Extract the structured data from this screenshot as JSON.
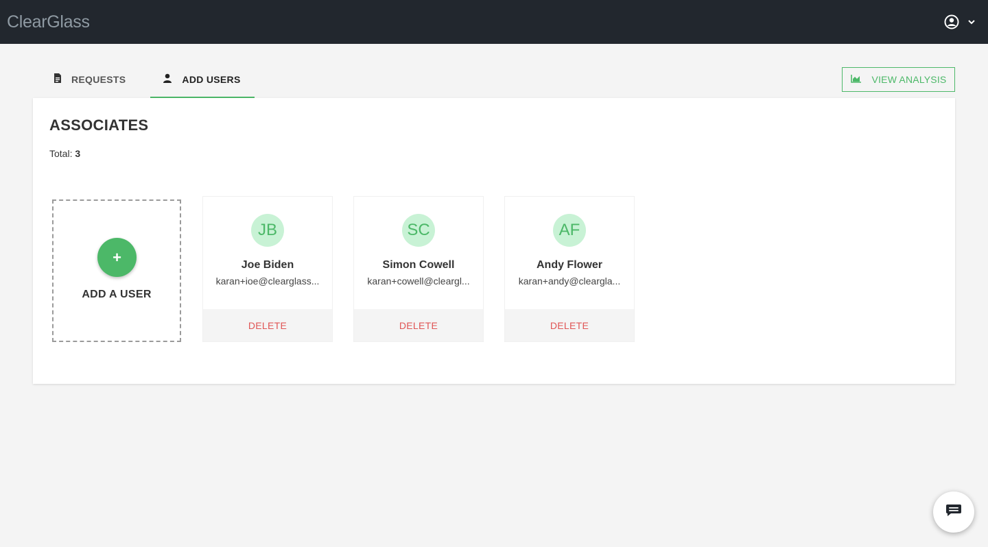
{
  "app": {
    "logo": "ClearGlass"
  },
  "header": {
    "account_icon": "user-circle-icon",
    "menu_icon": "chevron-down-icon"
  },
  "tabs": [
    {
      "label": "REQUESTS",
      "icon": "document-icon",
      "active": false
    },
    {
      "label": "ADD USERS",
      "icon": "user-icon",
      "active": true
    }
  ],
  "actions": {
    "view_analysis": "VIEW ANALYSIS",
    "view_analysis_icon": "chart-icon"
  },
  "panel": {
    "title": "ASSOCIATES",
    "total_label": "Total:",
    "total_count": "3",
    "add_user": {
      "symbol": "+",
      "label": "ADD A USER"
    },
    "users": [
      {
        "initials": "JB",
        "name": "Joe Biden",
        "email": "karan+ioe@clearglass...",
        "delete_label": "DELETE"
      },
      {
        "initials": "SC",
        "name": "Simon Cowell",
        "email": "karan+cowell@cleargl...",
        "delete_label": "DELETE"
      },
      {
        "initials": "AF",
        "name": "Andy Flower",
        "email": "karan+andy@cleargla...",
        "delete_label": "DELETE"
      }
    ]
  },
  "colors": {
    "accent": "#4cb868",
    "danger": "#e05555",
    "topbar": "#22272e",
    "avatar_bg": "#c8f2d5"
  },
  "chat": {
    "icon": "chat-icon"
  }
}
